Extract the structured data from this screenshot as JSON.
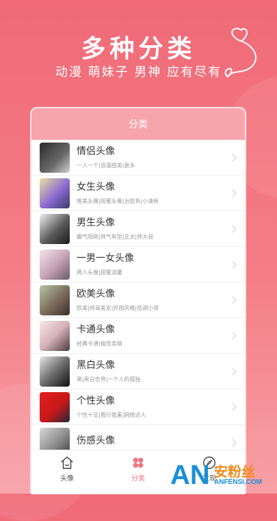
{
  "promo": {
    "title": "多种分类",
    "subtitle": "动漫 萌妹子 男神 应有尽有"
  },
  "header": {
    "title": "分类"
  },
  "categories": [
    {
      "title": "情侣头像",
      "desc": "一人一个|浪漫甜美|更多"
    },
    {
      "title": "女生头像",
      "desc": "唯美头像|闺蜜头像|治愈系|小清新"
    },
    {
      "title": "男生头像",
      "desc": "霸气阳刚|帅气有型|正太|帅大叔"
    },
    {
      "title": "一男一女头像",
      "desc": "两人头像|甜蜜温馨"
    },
    {
      "title": "欧美头像",
      "desc": "欧美|帅哥美女|异国风格|低调小资"
    },
    {
      "title": "卡通头像",
      "desc": "经典卡通|搞怪卖萌"
    },
    {
      "title": "黑白头像",
      "desc": "黑|黑白世界|一个人的孤独"
    },
    {
      "title": "个性头像",
      "desc": "个性十足|我行我素|网络达人"
    },
    {
      "title": "伤感头像",
      "desc": ""
    }
  ],
  "tabs": [
    {
      "label": "头像",
      "icon": "house-icon"
    },
    {
      "label": "分类",
      "icon": "flower-icon"
    },
    {
      "label": "发现",
      "icon": "compass-icon"
    }
  ],
  "watermark": {
    "an": "AN",
    "cn": "安粉丝",
    "en": "ANFENSI.COM"
  },
  "colors": {
    "accent": "#f07480",
    "header": "#f7a4ad"
  }
}
